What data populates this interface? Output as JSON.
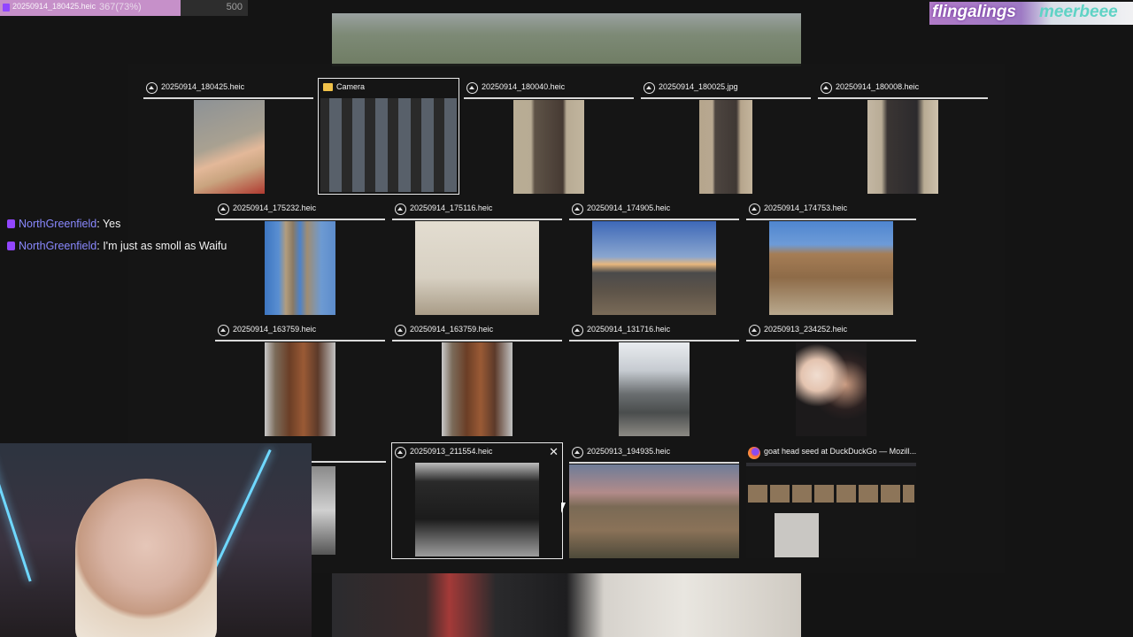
{
  "goal": {
    "title": "20250914_180425.heic",
    "count": "367(73%)",
    "max": "500",
    "fraction": 0.73
  },
  "names": {
    "left": "flingalings",
    "right": "meerbeee"
  },
  "chat": [
    {
      "user": "NorthGreenfield",
      "message": "Yes"
    },
    {
      "user": "NorthGreenfield",
      "message": "I'm just as smoll as Waifu"
    }
  ],
  "windows": [
    {
      "title": "20250914_180425.heic",
      "icon": "photos-icon"
    },
    {
      "title": "Camera",
      "icon": "folder-icon"
    },
    {
      "title": "20250914_180040.heic",
      "icon": "photos-icon"
    },
    {
      "title": "20250914_180025.jpg",
      "icon": "photos-icon"
    },
    {
      "title": "20250914_180008.heic",
      "icon": "photos-icon"
    },
    {
      "title": "20250914_175232.heic",
      "icon": "photos-icon"
    },
    {
      "title": "20250914_175116.heic",
      "icon": "photos-icon"
    },
    {
      "title": "20250914_174905.heic",
      "icon": "photos-icon"
    },
    {
      "title": "20250914_174753.heic",
      "icon": "photos-icon"
    },
    {
      "title": "20250914_163759.heic",
      "icon": "photos-icon"
    },
    {
      "title": "20250914_163759.heic",
      "icon": "photos-icon"
    },
    {
      "title": "20250914_131716.heic",
      "icon": "photos-icon"
    },
    {
      "title": "20250913_234252.heic",
      "icon": "photos-icon"
    },
    {
      "title": "20250913_211554.heic",
      "icon": "photos-icon"
    },
    {
      "title": "20250913_194935.heic",
      "icon": "photos-icon"
    },
    {
      "title": "goat head seed at DuckDuckGo — Mozill...",
      "icon": "firefox-icon"
    }
  ],
  "colors": {
    "accent": "#9146ff",
    "chat_user": "#8a89ff",
    "goal_fill": "#c690c9"
  }
}
